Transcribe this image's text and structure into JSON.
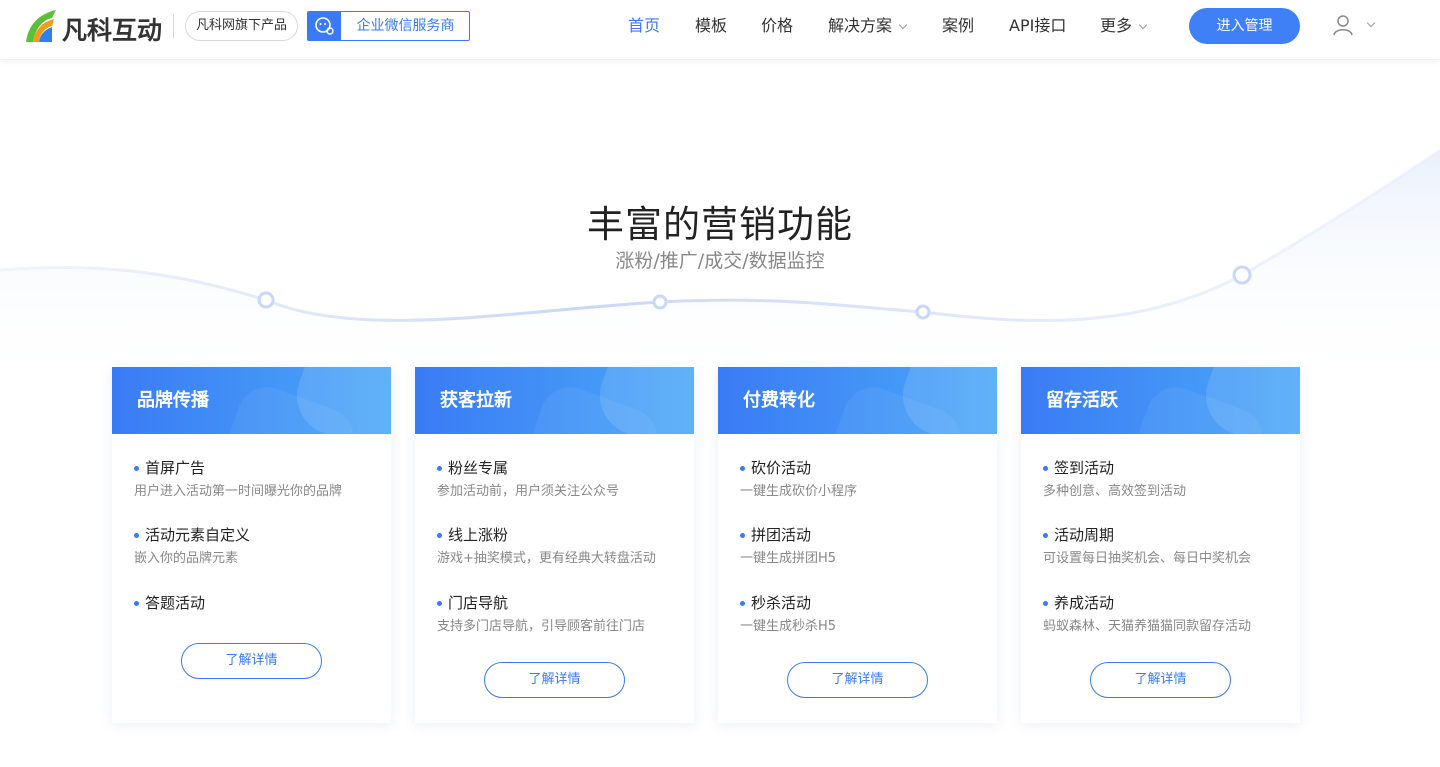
{
  "header": {
    "brand": "凡科互动",
    "parent_label": "凡科网旗下产品",
    "wx_label": "企业微信服务商",
    "nav": [
      {
        "label": "首页",
        "active": true
      },
      {
        "label": "模板"
      },
      {
        "label": "价格"
      },
      {
        "label": "解决方案"
      },
      {
        "label": "案例"
      },
      {
        "label": "API接口"
      },
      {
        "label": "更多"
      }
    ],
    "manage_button": "进入管理"
  },
  "hero": {
    "title": "丰富的营销功能",
    "subtitle": "涨粉/推广/成交/数据监控"
  },
  "cards": [
    {
      "title": "品牌传播",
      "features": [
        {
          "name": "首屏广告",
          "desc": "用户进入活动第一时间曝光你的品牌"
        },
        {
          "name": "活动元素自定义",
          "desc": "嵌入你的品牌元素"
        },
        {
          "name": "答题活动",
          "desc": ""
        }
      ],
      "button": "了解详情"
    },
    {
      "title": "获客拉新",
      "features": [
        {
          "name": "粉丝专属",
          "desc": "参加活动前，用户须关注公众号"
        },
        {
          "name": "线上涨粉",
          "desc": "游戏+抽奖模式，更有经典大转盘活动"
        },
        {
          "name": "门店导航",
          "desc": "支持多门店导航，引导顾客前往门店"
        }
      ],
      "button": "了解详情"
    },
    {
      "title": "付费转化",
      "features": [
        {
          "name": "砍价活动",
          "desc": "一键生成砍价小程序"
        },
        {
          "name": "拼团活动",
          "desc": "一键生成拼团H5"
        },
        {
          "name": "秒杀活动",
          "desc": "一键生成秒杀H5"
        }
      ],
      "button": "了解详情"
    },
    {
      "title": "留存活跃",
      "features": [
        {
          "name": "签到活动",
          "desc": "多种创意、高效签到活动"
        },
        {
          "name": "活动周期",
          "desc": "可设置每日抽奖机会、每日中奖机会"
        },
        {
          "name": "养成活动",
          "desc": "蚂蚁森林、天猫养猫猫同款留存活动"
        }
      ],
      "button": "了解详情"
    }
  ],
  "colors": {
    "accent": "#3a7bf5",
    "card_head_start": "#3a7bf5",
    "card_head_end": "#4aa8f8",
    "muted_text": "#888888"
  },
  "icons": {
    "logo": "fanke-logo-icon",
    "wechat": "wechat-service-icon",
    "user": "user-icon",
    "chevron": "chevron-down-icon"
  }
}
